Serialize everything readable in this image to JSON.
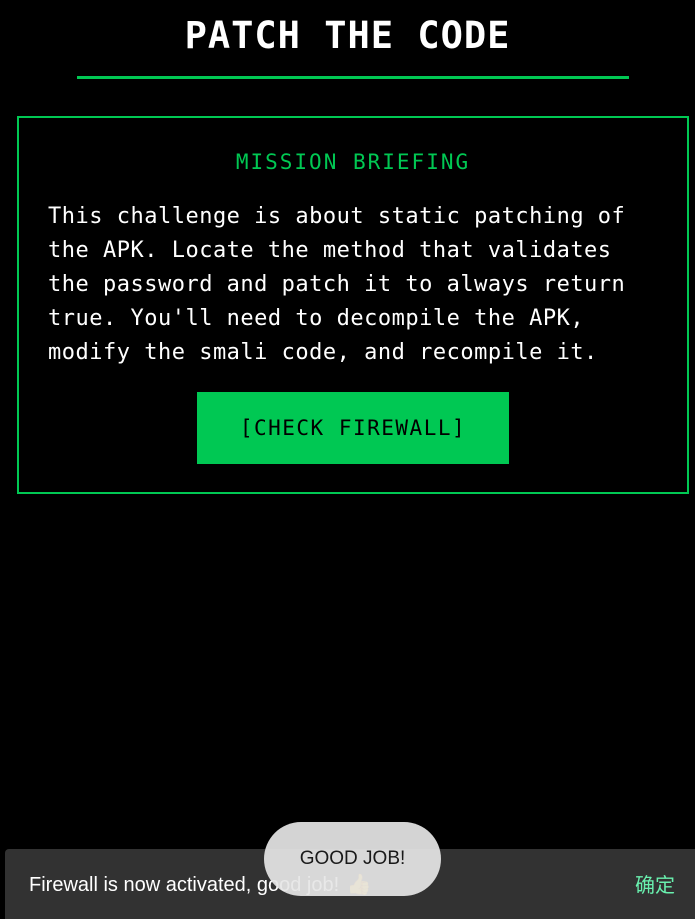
{
  "header": {
    "title": "PATCH THE CODE"
  },
  "briefing": {
    "heading": "MISSION BRIEFING",
    "body": "This challenge is about static patching of the APK. Locate the method that validates the password and patch it to always return true. You'll need to decompile the APK, modify the smali code, and recompile it.",
    "button_label": "[CHECK FIREWALL]"
  },
  "snackbar": {
    "message": "Firewall is now activated, good job!",
    "emoji": "👍",
    "action_label": "确定"
  },
  "toast": {
    "message": "GOOD JOB!"
  },
  "colors": {
    "background": "#000000",
    "accent": "#00c853",
    "snackbar_background": "#323232",
    "snackbar_action": "#69f0ae"
  }
}
